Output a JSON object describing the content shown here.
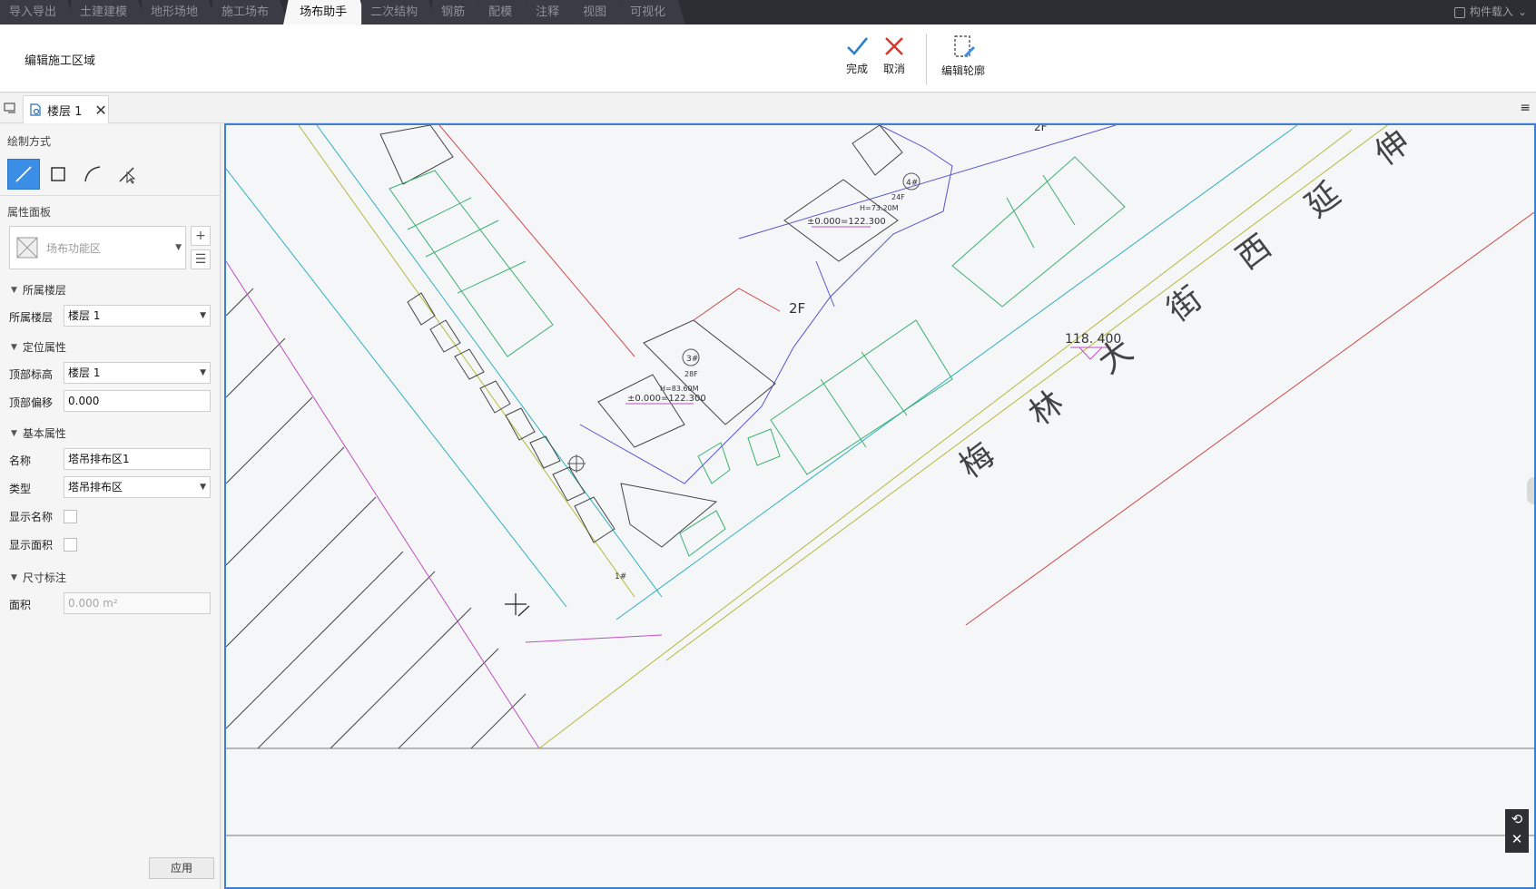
{
  "top_tabs": [
    {
      "label": "导入导出"
    },
    {
      "label": "土建建模"
    },
    {
      "label": "地形场地"
    },
    {
      "label": "施工场布"
    },
    {
      "label": "场布助手",
      "active": true
    },
    {
      "label": "二次结构"
    },
    {
      "label": "钢筋"
    },
    {
      "label": "配模"
    },
    {
      "label": "注释"
    },
    {
      "label": "视图"
    },
    {
      "label": "可视化"
    }
  ],
  "load_label": "构件载入",
  "ribbon": {
    "title": "编辑施工区域",
    "finish": "完成",
    "cancel": "取消",
    "edit_outline": "编辑轮廓"
  },
  "doc_tab": {
    "label": "楼层 1"
  },
  "left": {
    "draw_method": "绘制方式",
    "prop_panel": "属性面板",
    "component_placeholder": "场布功能区",
    "group_floor": "所属楼层",
    "floor_label": "所属楼层",
    "floor_value": "楼层 1",
    "group_position": "定位属性",
    "top_elev_label": "顶部标高",
    "top_elev_value": "楼层 1",
    "top_offset_label": "顶部偏移",
    "top_offset_value": "0.000",
    "group_basic": "基本属性",
    "name_label": "名称",
    "name_value": "塔吊排布区1",
    "type_label": "类型",
    "type_value": "塔吊排布区",
    "show_name_label": "显示名称",
    "show_area_label": "显示面积",
    "group_dim": "尺寸标注",
    "area_label": "面积",
    "area_value": "0.000 m²",
    "apply": "应用"
  },
  "canvas": {
    "street": "梅 林 大 街 西 延 伸 段",
    "level_mark": "118. 400",
    "label_2f": "2F",
    "label_2f_b": "2F",
    "bldg_4": "4#",
    "bldg_3": "3#",
    "floors_24f": "24F",
    "floors_28f": "28F",
    "height_4": "H=73.20M",
    "height_3": "H=83.60M",
    "elev_4": "±0.000=122.300",
    "elev_3": "±0.000=122.300",
    "tower_1": "1#"
  }
}
